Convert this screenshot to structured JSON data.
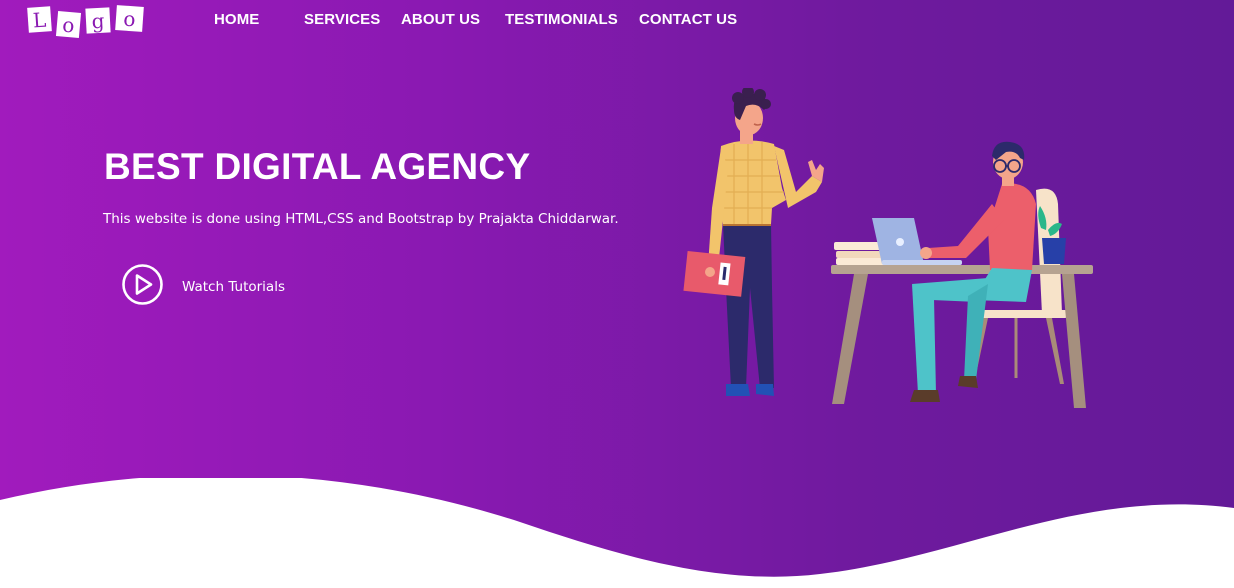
{
  "logo": {
    "letters": [
      "L",
      "o",
      "g",
      "o"
    ]
  },
  "nav": {
    "items": [
      {
        "label": "HOME"
      },
      {
        "label": "SERVICES"
      },
      {
        "label": "ABOUT US"
      },
      {
        "label": "TESTIMONIALS"
      },
      {
        "label": "CONTACT US"
      }
    ]
  },
  "hero": {
    "title": "BEST DIGITAL AGENCY",
    "subtitle": "This website is done using HTML,CSS and Bootstrap by Prajakta Chiddarwar.",
    "cta_label": "Watch Tutorials"
  },
  "colors": {
    "gradient_start": "#a11bbd",
    "gradient_end": "#631a98",
    "text": "#ffffff",
    "wave": "#ffffff"
  },
  "icons": {
    "cta": "play-circle-icon",
    "illustration": "office-team-illustration"
  }
}
